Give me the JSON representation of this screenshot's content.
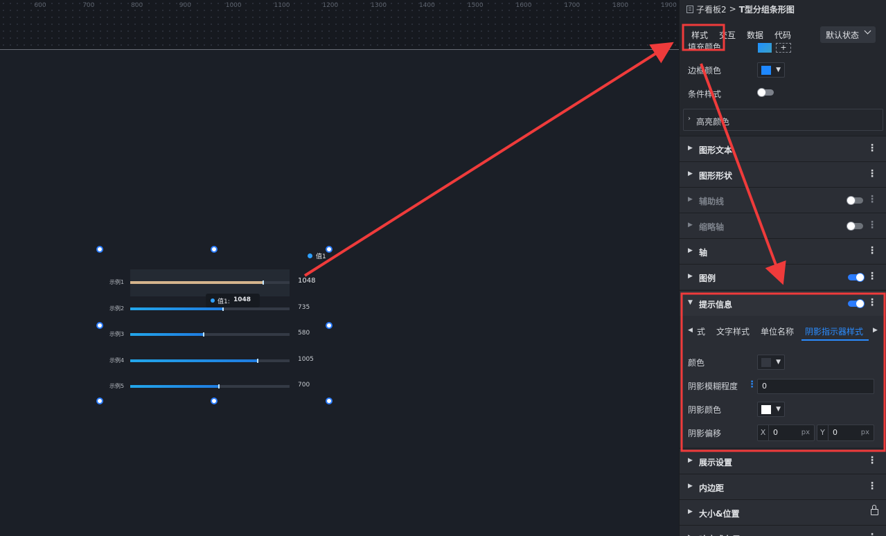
{
  "ruler": {
    "ticks": [
      "600",
      "700",
      "800",
      "900",
      "1000",
      "1100",
      "1200",
      "1300",
      "1400",
      "1500",
      "1600",
      "1700",
      "1800",
      "1900"
    ]
  },
  "chart": {
    "legend": "值1",
    "tooltip": {
      "series": "值1:",
      "value": "1048"
    },
    "accent_color": "#1f8ef0",
    "highlight_color": "#d4b48c"
  },
  "chart_data": {
    "type": "bar",
    "orientation": "horizontal",
    "categories": [
      "示例1",
      "示例2",
      "示例3",
      "示例4",
      "示例5"
    ],
    "series": [
      {
        "name": "值1",
        "values": [
          1048,
          735,
          580,
          1005,
          700
        ]
      }
    ],
    "xlim": [
      0,
      1250
    ],
    "value_labels": [
      "1048",
      "735",
      "580",
      "1005",
      "700"
    ],
    "legend_position": "top-right",
    "highlighted_index": 0
  },
  "panel": {
    "breadcrumb": {
      "parent": "子看板2",
      "separator": ">",
      "current": "T型分组条形图"
    },
    "tabs": [
      "样式",
      "交互",
      "数据",
      "代码"
    ],
    "state_select": "默认状态",
    "fill_label": "填充颜色",
    "border_color_label": "边框颜色",
    "border_color": "#1e88ff",
    "condition_label": "条件样式",
    "highlight_section": "高亮颜色",
    "sections_top": [
      {
        "title": "图形文本",
        "dim": false,
        "toggle": "none"
      },
      {
        "title": "图形形状",
        "dim": false,
        "toggle": "none"
      },
      {
        "title": "辅助线",
        "dim": true,
        "toggle": "off"
      },
      {
        "title": "缩略轴",
        "dim": true,
        "toggle": "off"
      },
      {
        "title": "轴",
        "dim": false,
        "toggle": "none"
      },
      {
        "title": "图例",
        "dim": false,
        "toggle": "on"
      }
    ],
    "tooltip_section": {
      "title": "提示信息",
      "subtabs": [
        "式",
        "文字样式",
        "单位名称",
        "阴影指示器样式"
      ],
      "active_subtab": "阴影指示器样式",
      "color_label": "颜色",
      "color_value": "#343841",
      "blur_label": "阴影模糊程度",
      "blur_value": "0",
      "shadow_color_label": "阴影颜色",
      "shadow_color_value": "#ffffff",
      "offset_label": "阴影偏移",
      "offset_x_axis": "X",
      "offset_x": "0",
      "offset_y_axis": "Y",
      "offset_y": "0",
      "unit": "px"
    },
    "sections_bottom": [
      {
        "title": "展示设置",
        "icon": "kebab"
      },
      {
        "title": "内边距",
        "icon": "kebab"
      },
      {
        "title": "大小&位置",
        "icon": "lock"
      },
      {
        "title": "响应式布局",
        "icon": "kebab"
      }
    ]
  },
  "annotation_color": "#ef3b3b"
}
